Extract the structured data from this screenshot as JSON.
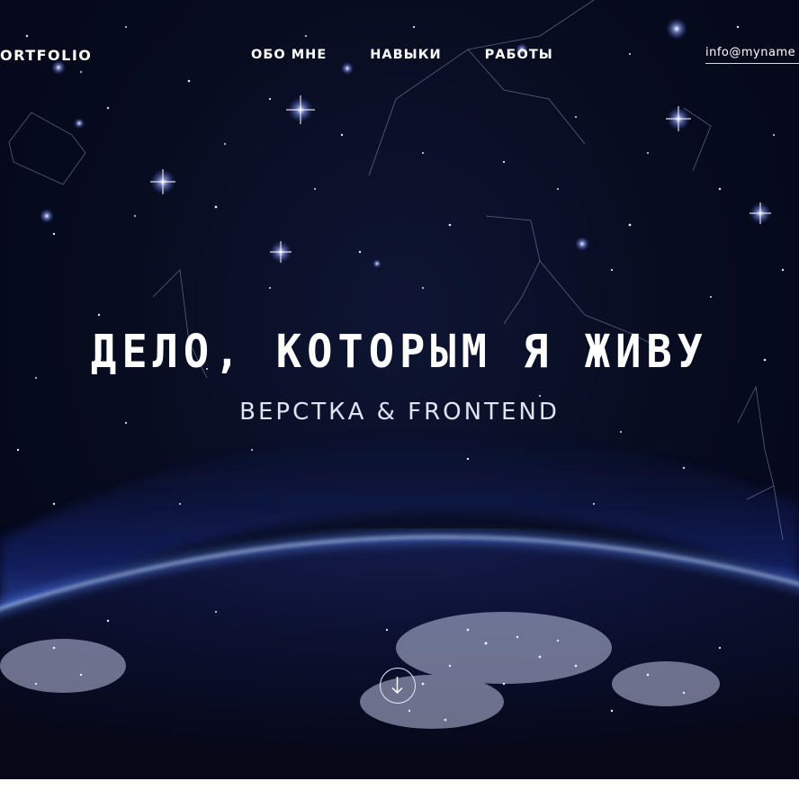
{
  "header": {
    "logo": "ORTFOLIO",
    "nav": [
      {
        "label": "ОБО МНЕ"
      },
      {
        "label": "НАВЫКИ"
      },
      {
        "label": "РАБОТЫ"
      }
    ],
    "email": "info@myname"
  },
  "hero": {
    "title": "ДЕЛО, КОТОРЫМ Я ЖИВУ",
    "subtitle": "ВЕРСТКА & FRONTEND",
    "scroll_icon": "arrow-down-circle-icon",
    "background": "night-earth-starfield"
  },
  "colors": {
    "space": "#070b1e",
    "atmosphere": "#3c6cff",
    "text": "#ffffff"
  }
}
